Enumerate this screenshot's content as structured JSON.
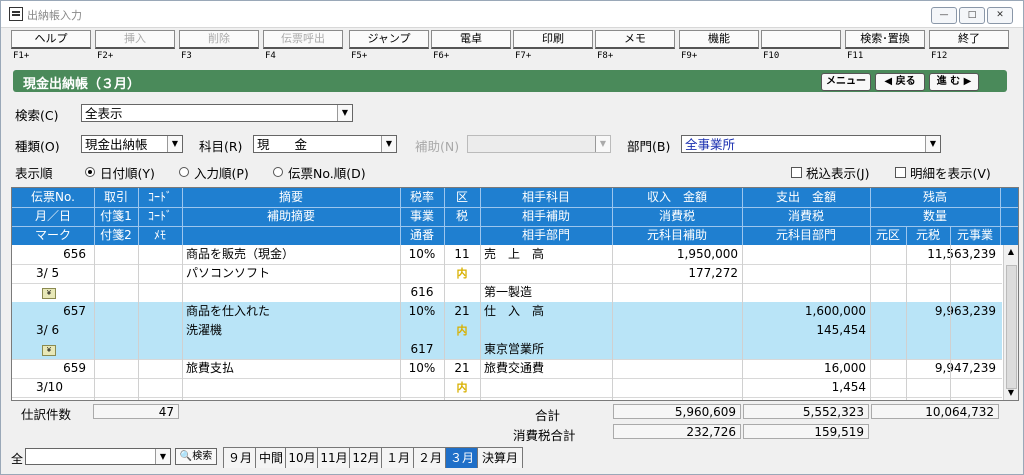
{
  "window": {
    "title": "出納帳入力"
  },
  "fkeys": [
    {
      "label": "ヘルプ",
      "key": "F1+",
      "disabled": false
    },
    {
      "label": "挿入",
      "key": "F2+",
      "disabled": true
    },
    {
      "label": "削除",
      "key": "F3",
      "disabled": true
    },
    {
      "label": "伝票呼出",
      "key": "F4",
      "disabled": true
    },
    {
      "label": "ジャンプ",
      "key": "F5+",
      "disabled": false
    },
    {
      "label": "電卓",
      "key": "F6+",
      "disabled": false
    },
    {
      "label": "印刷",
      "key": "F7+",
      "disabled": false
    },
    {
      "label": "メモ",
      "key": "F8+",
      "disabled": false
    },
    {
      "label": "機能",
      "key": "F9+",
      "disabled": false
    },
    {
      "label": "",
      "key": "F10",
      "disabled": false
    },
    {
      "label": "検索･置換",
      "key": "F11",
      "disabled": false
    },
    {
      "label": "終了",
      "key": "F12",
      "disabled": false
    }
  ],
  "header": {
    "title": "現金出納帳（３月）",
    "menu": "メニュー",
    "back": "◀ 戻る",
    "next": "進 む ▶"
  },
  "filters": {
    "search_label": "検索(C)",
    "search_value": "全表示",
    "type_label": "種類(O)",
    "type_value": "現金出納帳",
    "account_label": "科目(R)",
    "account_value": "現　　金",
    "sub_label": "補助(N)",
    "sub_value": "",
    "dept_label": "部門(B)",
    "dept_value": "全事業所",
    "order_label": "表示順",
    "order_options": [
      "日付順(Y)",
      "入力順(P)",
      "伝票No.順(D)"
    ],
    "tax_incl": "税込表示(J)",
    "detail": "明細を表示(V)"
  },
  "grid_header": {
    "row1": [
      "伝票No.",
      "取引",
      "ｺｰﾄﾞ",
      "摘要",
      "税率",
      "区",
      "相手科目",
      "収入　金額",
      "支出　金額",
      "残高"
    ],
    "row2": [
      "月／日",
      "付箋1",
      "ｺｰﾄﾞ",
      "補助摘要",
      "事業",
      "税",
      "相手補助",
      "消費税",
      "消費税",
      "数量"
    ],
    "row3": [
      "マーク",
      "付箋2",
      "ﾒﾓ",
      "",
      "通番",
      "",
      "相手部門",
      "元科目補助",
      "元科目部門",
      "元区",
      "元税",
      "元事業"
    ]
  },
  "entries": [
    {
      "no": "656",
      "date": "3/ 5",
      "desc": "商品を販売（現金）",
      "sub_desc": "パソコンソフト",
      "rate": "10%",
      "kubun": "11",
      "tax": "内",
      "serial": "616",
      "account": "売　上　高",
      "partner_dept": "第一製造",
      "income": "1,950,000",
      "income_tax": "177,272",
      "expense": "",
      "expense_tax": "",
      "balance": "11,563,239",
      "blue": false
    },
    {
      "no": "657",
      "date": "3/ 6",
      "desc": "商品を仕入れた",
      "sub_desc": "洗濯機",
      "rate": "10%",
      "kubun": "21",
      "tax": "内",
      "serial": "617",
      "account": "仕　入　高",
      "partner_dept": "東京営業所",
      "income": "",
      "income_tax": "",
      "expense": "1,600,000",
      "expense_tax": "145,454",
      "balance": "9,963,239",
      "blue": true
    },
    {
      "no": "659",
      "date": "3/10",
      "desc": "旅費支払",
      "sub_desc": "",
      "rate": "10%",
      "kubun": "21",
      "tax": "内",
      "serial": "",
      "account": "旅費交通費",
      "partner_dept": "",
      "income": "",
      "income_tax": "",
      "expense": "16,000",
      "expense_tax": "1,454",
      "balance": "9,947,239",
      "blue": false
    }
  ],
  "totals": {
    "count_label": "仕訳件数",
    "count": "47",
    "sum_label": "合計",
    "income_total": "5,960,609",
    "expense_total": "5,552,323",
    "balance_total": "10,064,732",
    "tax_label": "消費税合計",
    "income_tax_total": "232,726",
    "expense_tax_total": "159,519"
  },
  "bottom": {
    "all_label": "全",
    "search_btn": "検索",
    "tabs": [
      "９月",
      "中間",
      "10月",
      "11月",
      "12月",
      "１月",
      "２月",
      "３月",
      "決算月"
    ],
    "active_tab": "３月"
  },
  "colors": {
    "header_blue": "#1f7fd0",
    "row_blue": "#b9e4f7",
    "green_bar": "#4a8a5a",
    "active_tab": "#1f6fc8"
  }
}
